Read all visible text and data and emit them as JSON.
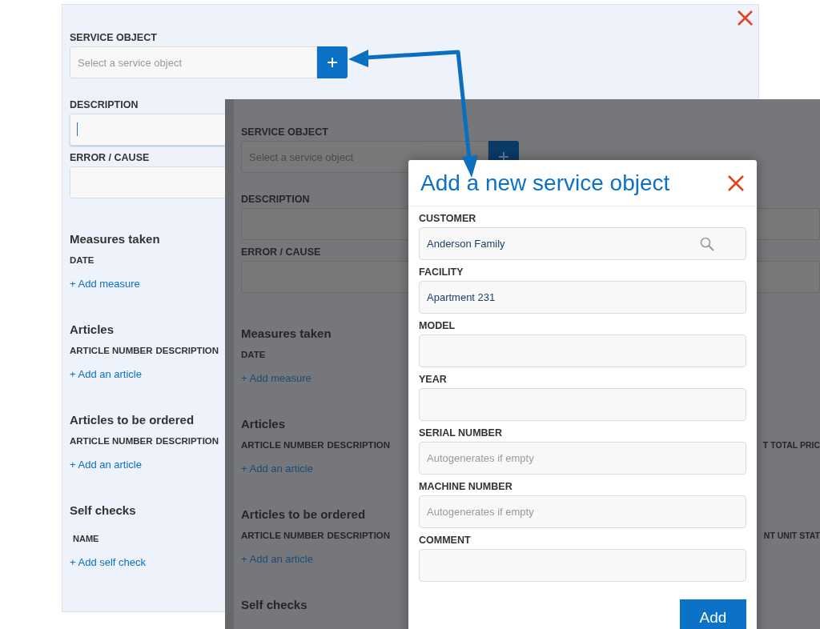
{
  "form": {
    "fields": [
      {
        "label": "SERVICE OBJECT",
        "kind": "select_add",
        "placeholder": "Select a service object",
        "focused": false
      },
      {
        "label": "DESCRIPTION",
        "kind": "text",
        "focused": true
      },
      {
        "label": "ERROR / CAUSE",
        "kind": "text",
        "focused": false
      }
    ],
    "lists": [
      {
        "title": "Measures taken",
        "columns": [
          "DATE"
        ],
        "link": "+ Add measure"
      },
      {
        "title": "Articles",
        "columns": [
          "ARTICLE NUMBER",
          "DESCRIPTION"
        ],
        "link": "+ Add an article"
      },
      {
        "title": "Articles to be ordered",
        "columns": [
          "ARTICLE NUMBER",
          "DESCRIPTION"
        ],
        "link": "+ Add an article"
      },
      {
        "title": "Self checks",
        "columns": [
          "NAME"
        ],
        "link": "+ Add self check",
        "kind": "small_header"
      }
    ]
  },
  "dimmed_form": {
    "fields": [
      {
        "label": "SERVICE OBJECT",
        "kind": "select_add",
        "placeholder": "Select a service object",
        "focused": false
      },
      {
        "label": "DESCRIPTION",
        "kind": "text",
        "focused": false
      },
      {
        "label": "ERROR / CAUSE",
        "kind": "text",
        "focused": false
      }
    ],
    "lists": [
      {
        "title": "Measures taken",
        "columns": [
          "DATE"
        ],
        "link": "+ Add measure"
      },
      {
        "title": "Articles",
        "columns": [
          "ARTICLE NUMBER",
          "DESCRIPTION"
        ],
        "partial_column": "T TOTAL PRIC",
        "link": "+ Add an article"
      },
      {
        "title": "Articles to be ordered",
        "columns": [
          "ARTICLE NUMBER",
          "DESCRIPTION"
        ],
        "partial_column": "NT UNIT STAT",
        "link": "+ Add an article"
      },
      {
        "title": "Self checks"
      }
    ]
  },
  "modal": {
    "title": "Add a new service object",
    "fields": [
      {
        "label": "CUSTOMER",
        "kind": "search",
        "value": "Anderson Family"
      },
      {
        "label": "FACILITY",
        "kind": "text",
        "value": "Apartment 231"
      },
      {
        "label": "MODEL",
        "kind": "text"
      },
      {
        "label": "YEAR",
        "kind": "text"
      },
      {
        "label": "SERIAL NUMBER",
        "kind": "text",
        "placeholder": "Autogenerates if empty"
      },
      {
        "label": "MACHINE NUMBER",
        "kind": "text",
        "placeholder": "Autogenerates if empty"
      },
      {
        "label": "COMMENT",
        "kind": "text"
      }
    ],
    "submit": "Add"
  }
}
